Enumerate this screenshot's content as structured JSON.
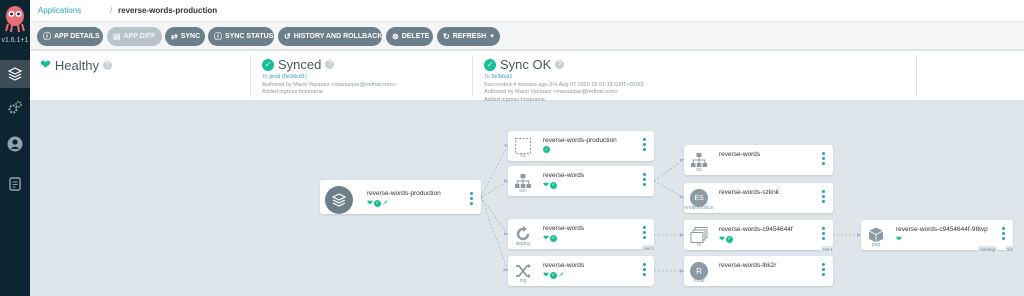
{
  "sidebar": {
    "version": "v1.6.1+1",
    "items": [
      {
        "icon": "layers-icon",
        "active": true
      },
      {
        "icon": "gears-icon",
        "active": false
      },
      {
        "icon": "user-icon",
        "active": false
      },
      {
        "icon": "docs-icon",
        "active": false
      }
    ]
  },
  "breadcrumb": {
    "parent": "Applications",
    "separator": "/",
    "current": "reverse-words-production"
  },
  "toolbar": {
    "app_details": "APP DETAILS",
    "app_diff": "APP DIFF",
    "sync": "SYNC",
    "sync_status": "SYNC STATUS",
    "history": "HISTORY AND ROLLBACK",
    "delete": "DELETE",
    "refresh": "REFRESH"
  },
  "health": {
    "label": "Healthy"
  },
  "sync": {
    "label": "Synced",
    "to_prefix": "To",
    "to_link": "prod (5e3dcd1)",
    "author": "Authored by Mario Vazquez <mavazque@redhat.com>",
    "message": "Added ingress hostname"
  },
  "operation": {
    "label": "Sync OK",
    "to_prefix": "To",
    "to_link": "5e3dcd1",
    "succeeded": "Succeeded 4 minutes ago (Fri Aug 07 2020 15:51:19 GMT+0200)",
    "author": "Authored by Mario Vazquez <mavazque@redhat.com>",
    "message": "Added ingress hostname"
  },
  "graph": {
    "app": {
      "name": "reverse-words-production"
    },
    "nodes": {
      "ns": {
        "name": "reverse-words-production",
        "kind": "ns"
      },
      "svc": {
        "name": "reverse-words",
        "kind": "svc"
      },
      "deploy": {
        "name": "reverse-words",
        "kind": "deploy",
        "badge": "rev:1"
      },
      "ing": {
        "name": "reverse-words",
        "kind": "ing"
      },
      "ep": {
        "name": "reverse-words",
        "kind": "ep"
      },
      "eps": {
        "name": "reverse-words-szknk",
        "kind": "endpointslice",
        "abbr": "ES"
      },
      "rs": {
        "name": "reverse-words-c9454644f",
        "kind": "rs",
        "badge": "rev:1"
      },
      "route": {
        "name": "reverse-words-lbk2r",
        "kind": "route",
        "abbr": "R"
      },
      "pod": {
        "name": "reverse-words-c9454644f-98tvp",
        "kind": "pod",
        "badge_status": "running",
        "badge_count": "1/1"
      }
    }
  }
}
